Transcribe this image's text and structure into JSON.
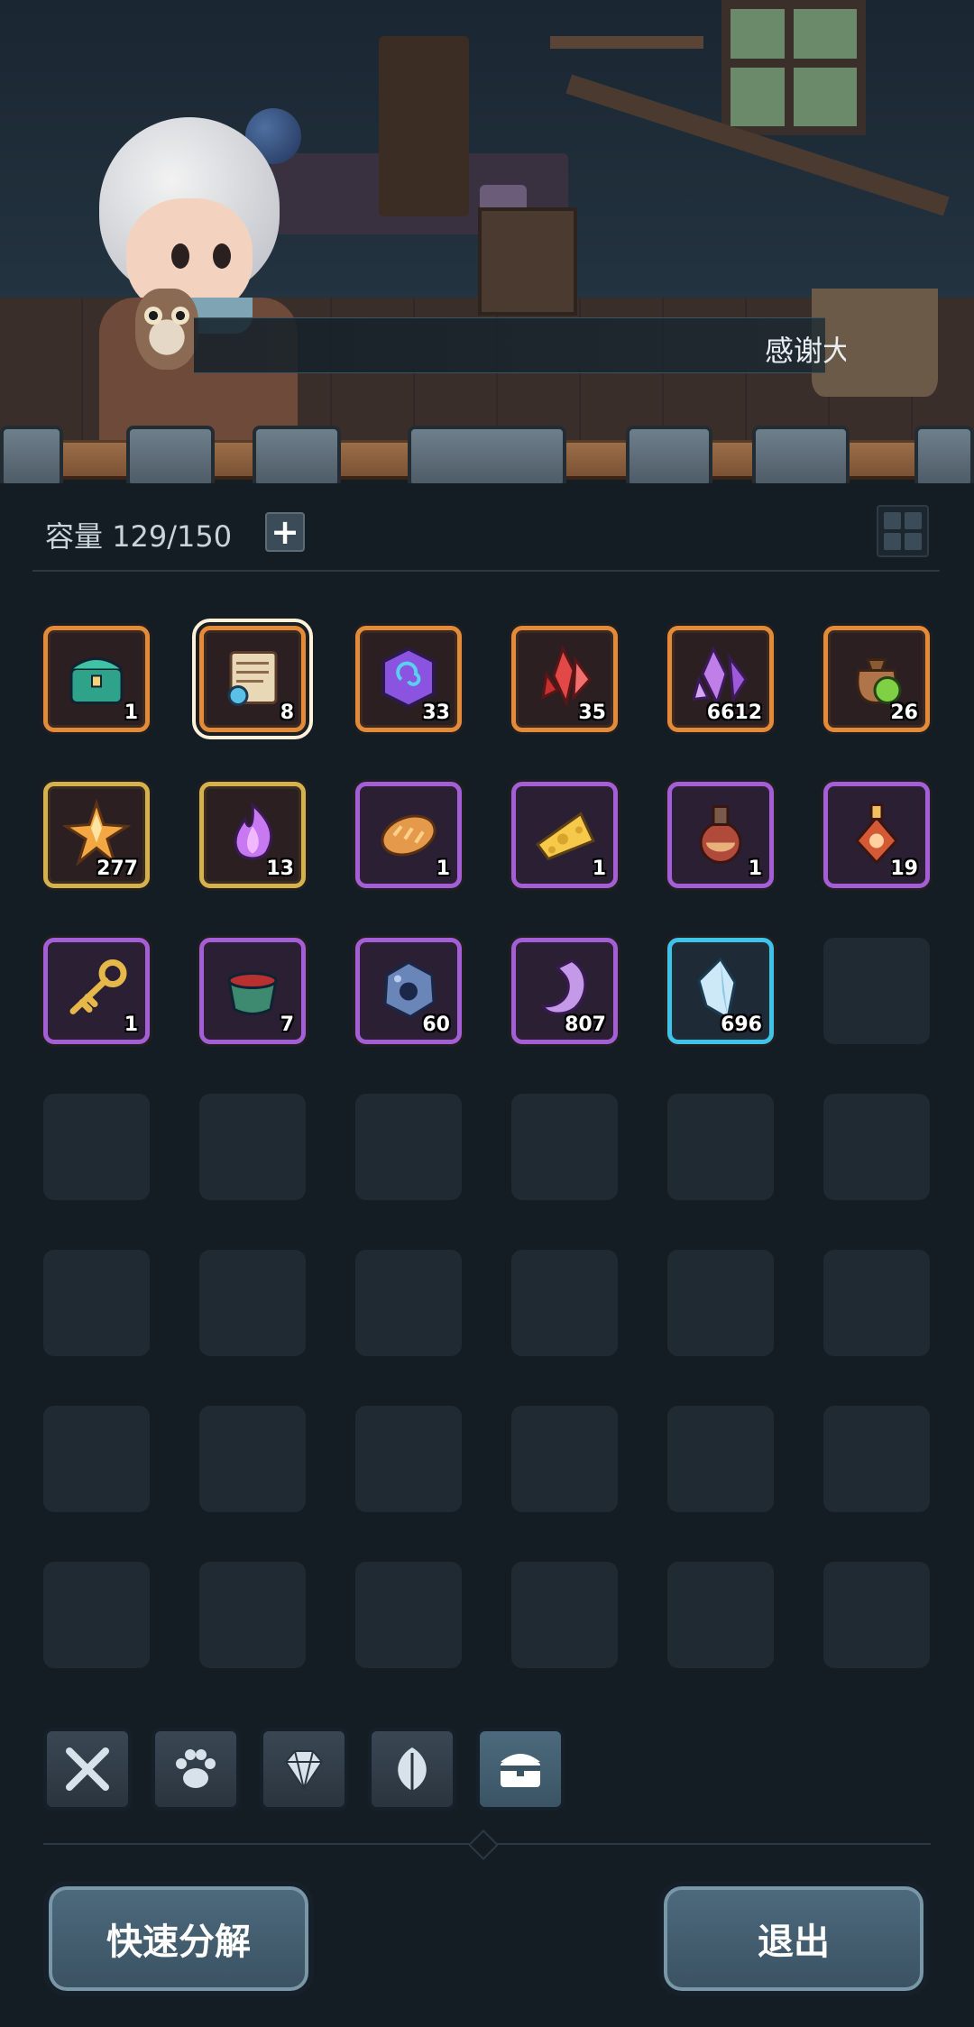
{
  "dialog": {
    "text": "感谢大"
  },
  "inventory_header": {
    "capacity_label": "容量",
    "capacity_value": "129/150",
    "expand_symbol": "+"
  },
  "items": [
    {
      "icon": "teal-chest-icon",
      "count": "1",
      "rarity": "orange"
    },
    {
      "icon": "scroll-map-icon",
      "count": "8",
      "rarity": "orange",
      "selected": true
    },
    {
      "icon": "purple-rune-coin-icon",
      "count": "33",
      "rarity": "orange"
    },
    {
      "icon": "red-crystal-icon",
      "count": "35",
      "rarity": "orange"
    },
    {
      "icon": "purple-crystal-cluster-icon",
      "count": "6612",
      "rarity": "orange"
    },
    {
      "icon": "seed-pouch-icon",
      "count": "26",
      "rarity": "orange"
    },
    {
      "icon": "star-crystal-icon",
      "count": "277",
      "rarity": "gold"
    },
    {
      "icon": "purple-flame-icon",
      "count": "13",
      "rarity": "gold"
    },
    {
      "icon": "bread-loaf-icon",
      "count": "1",
      "rarity": "purple"
    },
    {
      "icon": "cheese-icon",
      "count": "1",
      "rarity": "purple"
    },
    {
      "icon": "potion-flask-icon",
      "count": "1",
      "rarity": "purple"
    },
    {
      "icon": "potion-bottle-icon",
      "count": "19",
      "rarity": "purple"
    },
    {
      "icon": "golden-key-icon",
      "count": "1",
      "rarity": "purple"
    },
    {
      "icon": "meat-pot-icon",
      "count": "7",
      "rarity": "purple"
    },
    {
      "icon": "blue-ore-icon",
      "count": "60",
      "rarity": "purple"
    },
    {
      "icon": "purple-tooth-icon",
      "count": "807",
      "rarity": "purple"
    },
    {
      "icon": "ice-crystal-icon",
      "count": "696",
      "rarity": "blue"
    }
  ],
  "tabs": [
    {
      "icon": "crossed-weapons-icon"
    },
    {
      "icon": "paw-icon"
    },
    {
      "icon": "gem-icon"
    },
    {
      "icon": "leaf-icon"
    },
    {
      "icon": "chest-icon",
      "active": true
    }
  ],
  "buttons": {
    "decompose": "快速分解",
    "exit": "退出"
  },
  "colors": {
    "orange": "#e48b3a",
    "gold": "#d6b24d",
    "purple": "#a45fd6",
    "blue": "#3fc3e8"
  }
}
